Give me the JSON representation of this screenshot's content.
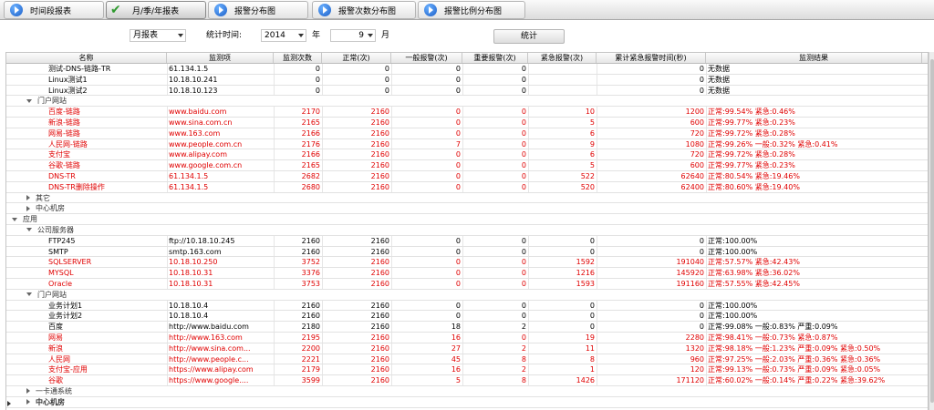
{
  "tabs": [
    {
      "label": "时间段报表",
      "active": false
    },
    {
      "label": "月/季/年报表",
      "active": true
    },
    {
      "label": "报警分布图",
      "active": false
    },
    {
      "label": "报警次数分布图",
      "active": false
    },
    {
      "label": "报警比例分布图",
      "active": false
    }
  ],
  "filter": {
    "report_type": "月报表",
    "stat_time_label": "统计时间:",
    "year": "2014",
    "year_unit": "年",
    "month": "9",
    "month_unit": "月",
    "stat_button": "统计"
  },
  "columns": [
    "名称",
    "监测项",
    "监测次数",
    "正常(次)",
    "一般报警(次)",
    "重要报警(次)",
    "紧急报警(次)",
    "累计紧急报警时间(秒)",
    "监测结果"
  ],
  "rows": [
    {
      "kind": "data",
      "level": 2,
      "red": false,
      "cells": [
        "测试-DNS-链路-TR",
        "61.134.1.5",
        "0",
        "0",
        "0",
        "0",
        "",
        "0",
        "无数据"
      ]
    },
    {
      "kind": "data",
      "level": 2,
      "red": false,
      "cells": [
        "Linux测试1",
        "10.18.10.241",
        "0",
        "0",
        "0",
        "0",
        "",
        "0",
        "无数据"
      ]
    },
    {
      "kind": "data",
      "level": 2,
      "red": false,
      "cells": [
        "Linux测试2",
        "10.18.10.123",
        "0",
        "0",
        "0",
        "0",
        "",
        "0",
        "无数据"
      ]
    },
    {
      "kind": "group",
      "level": 1,
      "expanded": true,
      "label": "门户网站"
    },
    {
      "kind": "data",
      "level": 2,
      "red": true,
      "cells": [
        "百度-链路",
        "www.baidu.com",
        "2170",
        "2160",
        "0",
        "0",
        "10",
        "1200",
        "正常:99.54% 紧急:0.46%"
      ]
    },
    {
      "kind": "data",
      "level": 2,
      "red": true,
      "cells": [
        "新浪-链路",
        "www.sina.com.cn",
        "2165",
        "2160",
        "0",
        "0",
        "5",
        "600",
        "正常:99.77% 紧急:0.23%"
      ]
    },
    {
      "kind": "data",
      "level": 2,
      "red": true,
      "cells": [
        "网易-链路",
        "www.163.com",
        "2166",
        "2160",
        "0",
        "0",
        "6",
        "720",
        "正常:99.72% 紧急:0.28%"
      ]
    },
    {
      "kind": "data",
      "level": 2,
      "red": true,
      "cells": [
        "人民网-链路",
        "www.people.com.cn",
        "2176",
        "2160",
        "7",
        "0",
        "9",
        "1080",
        "正常:99.26% 一般:0.32% 紧急:0.41%"
      ]
    },
    {
      "kind": "data",
      "level": 2,
      "red": true,
      "cells": [
        "支付宝",
        "www.alipay.com",
        "2166",
        "2160",
        "0",
        "0",
        "6",
        "720",
        "正常:99.72% 紧急:0.28%"
      ]
    },
    {
      "kind": "data",
      "level": 2,
      "red": true,
      "cells": [
        "谷歌-链路",
        "www.google.com.cn",
        "2165",
        "2160",
        "0",
        "0",
        "5",
        "600",
        "正常:99.77% 紧急:0.23%"
      ]
    },
    {
      "kind": "data",
      "level": 2,
      "red": true,
      "cells": [
        "DNS-TR",
        "61.134.1.5",
        "2682",
        "2160",
        "0",
        "0",
        "522",
        "62640",
        "正常:80.54% 紧急:19.46%"
      ]
    },
    {
      "kind": "data",
      "level": 2,
      "red": true,
      "cells": [
        "DNS-TR删除操作",
        "61.134.1.5",
        "2680",
        "2160",
        "0",
        "0",
        "520",
        "62400",
        "正常:80.60% 紧急:19.40%"
      ]
    },
    {
      "kind": "group",
      "level": 1,
      "expanded": false,
      "label": "其它"
    },
    {
      "kind": "group",
      "level": 1,
      "expanded": false,
      "label": "中心机房"
    },
    {
      "kind": "group",
      "level": 0,
      "expanded": true,
      "label": "应用"
    },
    {
      "kind": "group",
      "level": 1,
      "expanded": true,
      "label": "公司服务器"
    },
    {
      "kind": "data",
      "level": 2,
      "red": false,
      "cells": [
        "FTP245",
        "ftp://10.18.10.245",
        "2160",
        "2160",
        "0",
        "0",
        "0",
        "0",
        "正常:100.00%"
      ]
    },
    {
      "kind": "data",
      "level": 2,
      "red": false,
      "cells": [
        "SMTP",
        "smtp.163.com",
        "2160",
        "2160",
        "0",
        "0",
        "0",
        "0",
        "正常:100.00%"
      ]
    },
    {
      "kind": "data",
      "level": 2,
      "red": true,
      "cells": [
        "SQLSERVER",
        "10.18.10.250",
        "3752",
        "2160",
        "0",
        "0",
        "1592",
        "191040",
        "正常:57.57% 紧急:42.43%"
      ]
    },
    {
      "kind": "data",
      "level": 2,
      "red": true,
      "cells": [
        "MYSQL",
        "10.18.10.31",
        "3376",
        "2160",
        "0",
        "0",
        "1216",
        "145920",
        "正常:63.98% 紧急:36.02%"
      ]
    },
    {
      "kind": "data",
      "level": 2,
      "red": true,
      "cells": [
        "Oracle",
        "10.18.10.31",
        "3753",
        "2160",
        "0",
        "0",
        "1593",
        "191160",
        "正常:57.55% 紧急:42.45%"
      ]
    },
    {
      "kind": "group",
      "level": 1,
      "expanded": true,
      "label": "门户网站"
    },
    {
      "kind": "data",
      "level": 2,
      "red": false,
      "cells": [
        "业务计划1",
        "10.18.10.4",
        "2160",
        "2160",
        "0",
        "0",
        "0",
        "0",
        "正常:100.00%"
      ]
    },
    {
      "kind": "data",
      "level": 2,
      "red": false,
      "cells": [
        "业务计划2",
        "10.18.10.4",
        "2160",
        "2160",
        "0",
        "0",
        "0",
        "0",
        "正常:100.00%"
      ]
    },
    {
      "kind": "data",
      "level": 2,
      "red": false,
      "cells": [
        "百度",
        "http://www.baidu.com",
        "2180",
        "2160",
        "18",
        "2",
        "0",
        "0",
        "正常:99.08% 一般:0.83% 严重:0.09%"
      ]
    },
    {
      "kind": "data",
      "level": 2,
      "red": true,
      "cells": [
        "网易",
        "http://www.163.com",
        "2195",
        "2160",
        "16",
        "0",
        "19",
        "2280",
        "正常:98.41% 一般:0.73% 紧急:0.87%"
      ]
    },
    {
      "kind": "data",
      "level": 2,
      "red": true,
      "cells": [
        "新浪",
        "http://www.sina.com...",
        "2200",
        "2160",
        "27",
        "2",
        "11",
        "1320",
        "正常:98.18% 一般:1.23% 严重:0.09% 紧急:0.50%"
      ]
    },
    {
      "kind": "data",
      "level": 2,
      "red": true,
      "cells": [
        "人民网",
        "http://www.people.c...",
        "2221",
        "2160",
        "45",
        "8",
        "8",
        "960",
        "正常:97.25% 一般:2.03% 严重:0.36% 紧急:0.36%"
      ]
    },
    {
      "kind": "data",
      "level": 2,
      "red": true,
      "cells": [
        "支付宝-应用",
        "https://www.alipay.com",
        "2179",
        "2160",
        "16",
        "2",
        "1",
        "120",
        "正常:99.13% 一般:0.73% 严重:0.09% 紧急:0.05%"
      ]
    },
    {
      "kind": "data",
      "level": 2,
      "red": true,
      "cells": [
        "谷歌",
        "https://www.google....",
        "3599",
        "2160",
        "5",
        "8",
        "1426",
        "171120",
        "正常:60.02% 一般:0.14% 严重:0.22% 紧急:39.62%"
      ]
    },
    {
      "kind": "group",
      "level": 1,
      "expanded": false,
      "label": "一卡通系统"
    },
    {
      "kind": "group",
      "level": 1,
      "expanded": false,
      "bold": true,
      "label": "中心机房"
    }
  ]
}
